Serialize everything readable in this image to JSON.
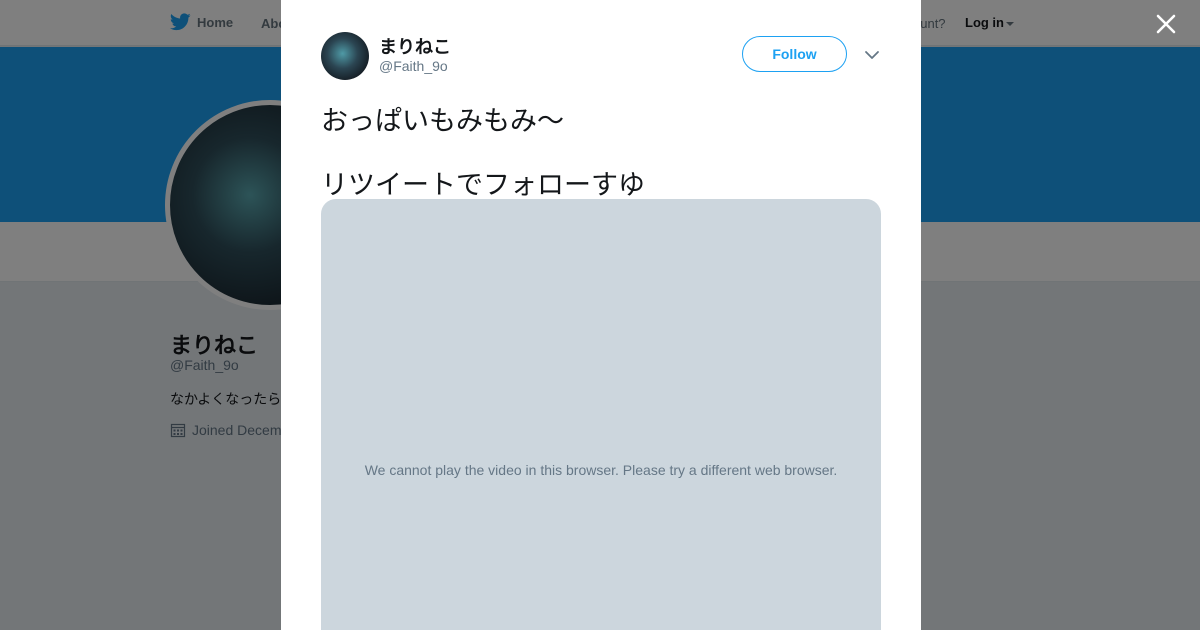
{
  "nav": {
    "home_label": "Home",
    "about_label": "Abo",
    "account_text": "ccount?",
    "login_label": "Log in"
  },
  "profile": {
    "name": "まりねこ",
    "handle": "@Faith_9o",
    "bio": "なかよくなったら",
    "joined": "Joined Decem"
  },
  "tweet": {
    "author_name": "まりねこ",
    "author_handle": "@Faith_9o",
    "follow_label": "Follow",
    "text_lines": [
      "おっぱいもみもみ〜",
      "リツイートでフォローすゆ"
    ],
    "media_message": "We cannot play the video in this browser. Please try a different web browser."
  },
  "icons": {
    "brand": "twitter-bird-icon",
    "close": "close-icon",
    "chevron": "chevron-down-icon",
    "calendar": "calendar-icon"
  },
  "colors": {
    "accent": "#1da1f2",
    "media_bg": "#ccd6dd",
    "muted_text": "#657786"
  }
}
